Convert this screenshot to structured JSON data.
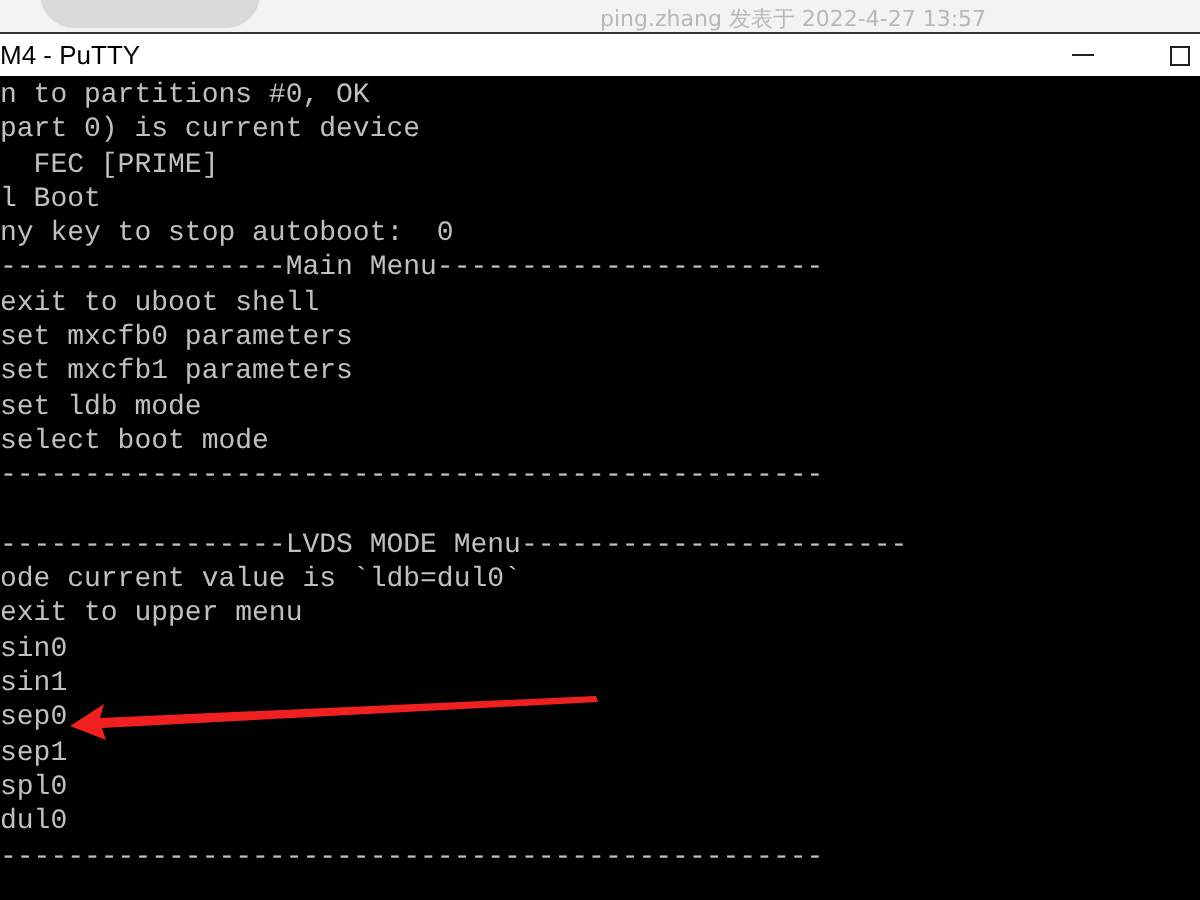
{
  "background": {
    "post_meta": "ping.zhang 发表于 2022-4-27 13:57"
  },
  "window": {
    "title": "M4 - PuTTY"
  },
  "terminal": {
    "blocks": [
      {
        "lines": [
          "n to partitions #0, OK",
          "part 0) is current device",
          "  FEC [PRIME]",
          "l Boot",
          "ny key to stop autoboot:  0",
          "-----------------Main Menu-----------------------",
          "exit to uboot shell",
          "set mxcfb0 parameters",
          "set mxcfb1 parameters",
          "set ldb mode",
          "select boot mode",
          "-------------------------------------------------"
        ]
      },
      {
        "lines": [
          "-----------------LVDS MODE Menu-----------------------",
          "ode current value is `ldb=dul0`",
          "exit to upper menu",
          "sin0",
          "sin1",
          "sep0",
          "sep1",
          "spl0",
          "dul0",
          "-------------------------------------------------"
        ]
      }
    ]
  }
}
